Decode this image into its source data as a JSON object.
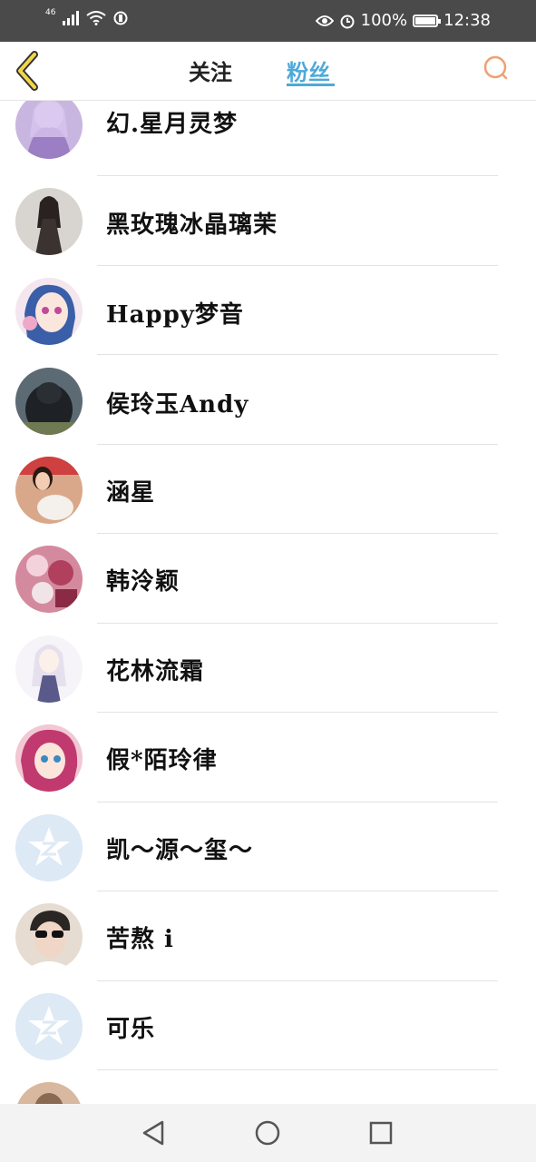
{
  "status_bar": {
    "network": "46",
    "battery": "100%",
    "time": "12:38"
  },
  "header": {
    "tabs": [
      {
        "label": "关注",
        "active": false
      },
      {
        "label": "粉丝",
        "active": true
      }
    ],
    "accent_color": "#4ea9d8",
    "back_icon": "chevron-left-icon",
    "search_icon": "search-icon"
  },
  "fans": [
    {
      "name": "幻.星月灵梦",
      "avatar": "anime-girl-purple"
    },
    {
      "name": "黑玫瑰冰晶璃茉",
      "avatar": "dark-dress-girl"
    },
    {
      "name": "Happy梦音",
      "avatar": "anime-girl-pink-hair"
    },
    {
      "name": "侯玲玉Andy",
      "avatar": "gorilla"
    },
    {
      "name": "涵星",
      "avatar": "girl-with-dog"
    },
    {
      "name": "韩泠颖",
      "avatar": "pink-pattern"
    },
    {
      "name": "花林流霜",
      "avatar": "anime-girl-white-hair"
    },
    {
      "name": "假*陌玲律",
      "avatar": "anime-girl-red-hair"
    },
    {
      "name": "凯～源～玺～",
      "avatar": "default-qq-avatar"
    },
    {
      "name": "苦熬 i",
      "avatar": "boy-sunglasses"
    },
    {
      "name": "可乐",
      "avatar": "default-qq-avatar"
    },
    {
      "name": "",
      "avatar": "partial-photo"
    }
  ]
}
